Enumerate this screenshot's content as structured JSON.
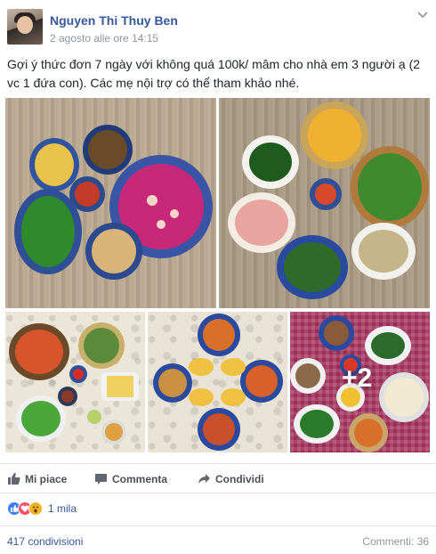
{
  "post": {
    "author": "Nguyen Thi Thuy Ben",
    "timestamp": "2 agosto alle ore 14:15",
    "caption": "Gợi ý thức đơn 7 ngày với không quá 100k/ mâm cho nhà em 3 người ạ (2 vc 1 đứa con). Các mẹ nội trợ có thể tham khảo nhé.",
    "photos": {
      "more_count": "+2"
    }
  },
  "actions": {
    "like": "Mi piace",
    "comment": "Commenta",
    "share": "Condividi"
  },
  "reactions": {
    "icons": [
      "like-icon",
      "love-icon",
      "wow-icon"
    ],
    "count": "1 mila"
  },
  "footer": {
    "shares": "417 condivisioni",
    "comments": "Commenti: 36"
  },
  "colors": {
    "link": "#365899",
    "muted": "#90949c",
    "like": "#4080ff",
    "love": "#f25268",
    "wow": "#f7b125"
  }
}
